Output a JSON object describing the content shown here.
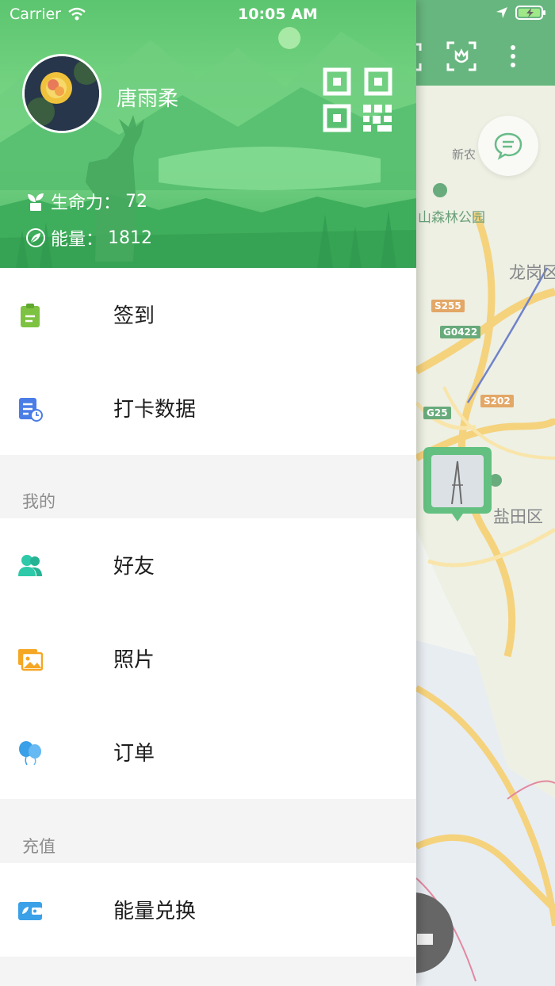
{
  "status_bar": {
    "carrier": "Carrier",
    "time": "10:05 AM"
  },
  "profile": {
    "username": "唐雨柔",
    "vitality_label": "生命力：",
    "vitality_value": "72",
    "energy_label": "能量：",
    "energy_value": "1812"
  },
  "menu": {
    "checkin": "签到",
    "punch_data": "打卡数据",
    "section_mine": "我的",
    "friends": "好友",
    "photos": "照片",
    "orders": "订单",
    "section_recharge": "充值",
    "energy_exchange": "能量兑换"
  },
  "map": {
    "labels": [
      "新农",
      "山森林公园",
      "龙岗区",
      "盐田区"
    ],
    "roads": [
      "S255",
      "G0422",
      "S202",
      "G25"
    ]
  },
  "colors": {
    "header_green": "#4fbf6a",
    "topbar_green": "#2f9a4e",
    "checkin_icon": "#7dc241",
    "data_icon": "#4a7de6",
    "friends_icon": "#2ec9a8",
    "photos_icon": "#f5a623",
    "orders_icon": "#3aa0e8",
    "wallet_icon": "#3aa0e8"
  },
  "icons": [
    "wifi-icon",
    "location-arrow-icon",
    "battery-icon",
    "qr-code-icon",
    "sprout-icon",
    "leaf-icon",
    "clipboard-icon",
    "document-clock-icon",
    "users-icon",
    "image-icon",
    "balloon-icon",
    "wallet-icon",
    "chat-icon",
    "scan-flower-icon",
    "more-vertical-icon"
  ]
}
